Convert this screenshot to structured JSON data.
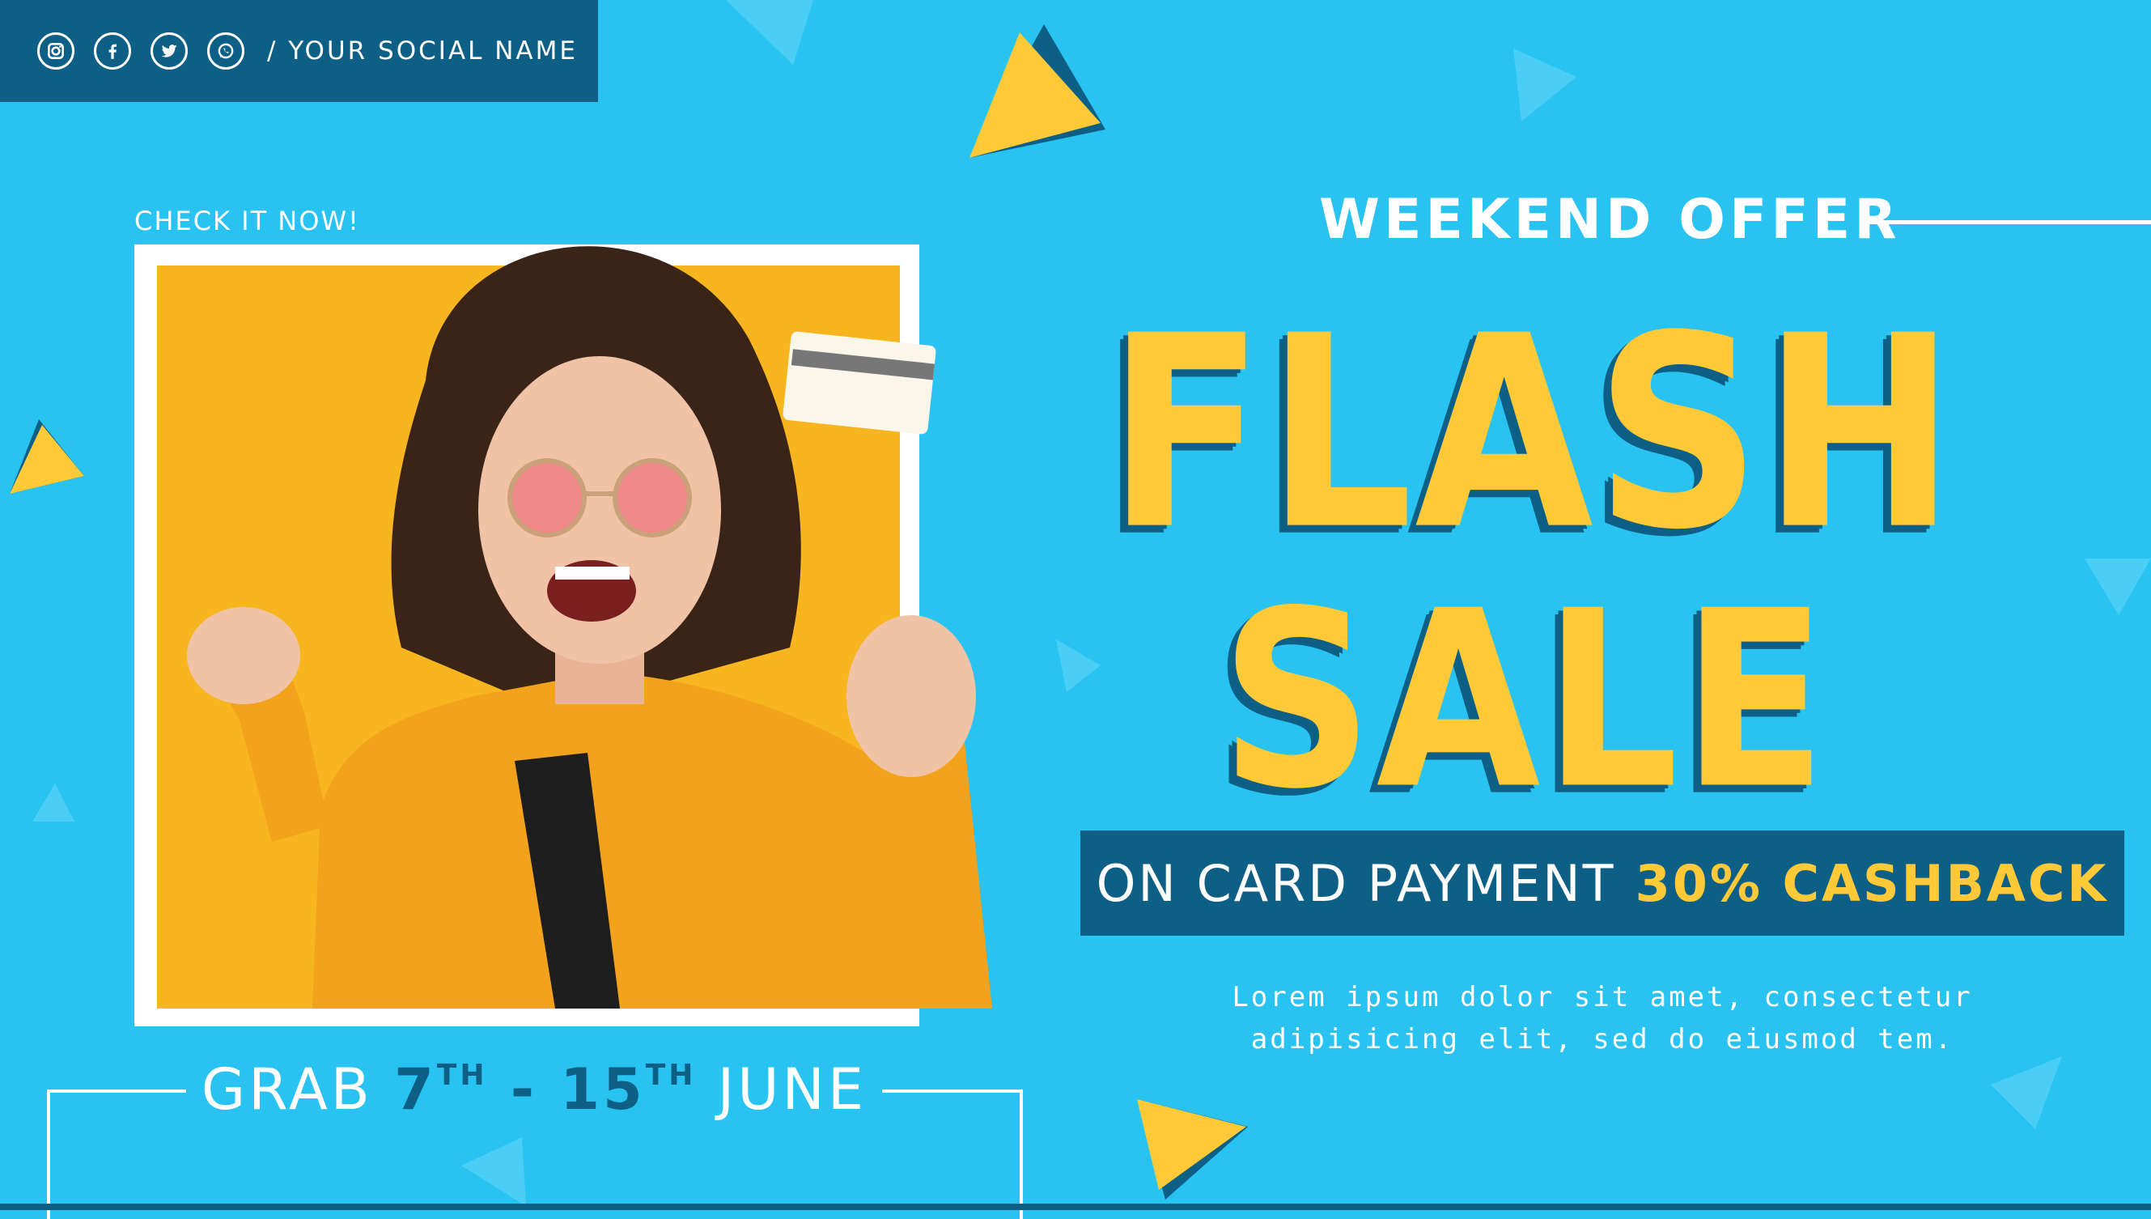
{
  "social": {
    "icons": [
      "instagram-icon",
      "facebook-icon",
      "twitter-icon",
      "whatsapp-icon"
    ],
    "name_label": "/ YOUR SOCIAL NAME"
  },
  "promo": {
    "check_label": "CHECK IT NOW!",
    "grab": {
      "prefix": "GRAB ",
      "start_day": "7",
      "start_suffix": "TH",
      "dash": " - ",
      "end_day": "15",
      "end_suffix": "TH",
      "month": " JUNE"
    },
    "weekend_label": "WEEKEND OFFER",
    "headline_line1": "FLASH",
    "headline_line2": "SALE",
    "card_text": "ON CARD PAYMENT",
    "cashback_text": "30% CASHBACK",
    "description_line1": "Lorem ipsum dolor sit amet, consectetur",
    "description_line2": "adipisicing elit, sed do eiusmod tem."
  },
  "colors": {
    "background": "#29c3f2",
    "navy": "#0e5f86",
    "yellow": "#ffc938",
    "photo_bg": "#f7b520"
  }
}
